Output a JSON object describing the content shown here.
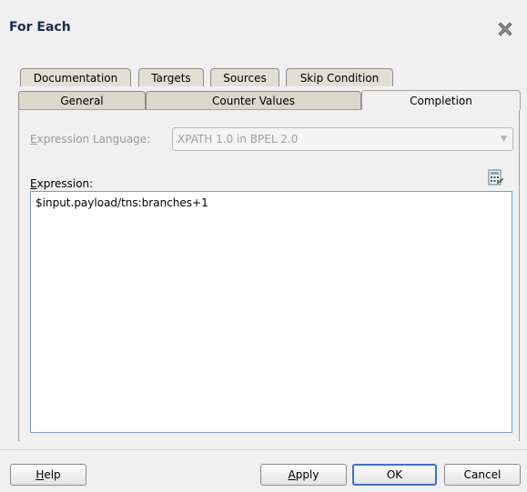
{
  "dialog": {
    "title": "For Each"
  },
  "tabs": {
    "back_row": [
      "Documentation",
      "Targets",
      "Sources",
      "Skip Condition"
    ],
    "front_row": [
      "General",
      "Counter Values",
      "Completion"
    ],
    "active": "Completion"
  },
  "completion": {
    "language_label": "Expression Language:",
    "language_value": "XPATH 1.0 in BPEL 2.0",
    "expression_label": "Expression:",
    "expression_value": "$input.payload/tns:branches+1"
  },
  "buttons": {
    "help": "Help",
    "apply": "Apply",
    "ok": "OK",
    "cancel": "Cancel"
  },
  "icons": {
    "close": "close-icon",
    "expression_builder": "expression-builder-icon",
    "dropdown": "chevron-down-icon"
  }
}
